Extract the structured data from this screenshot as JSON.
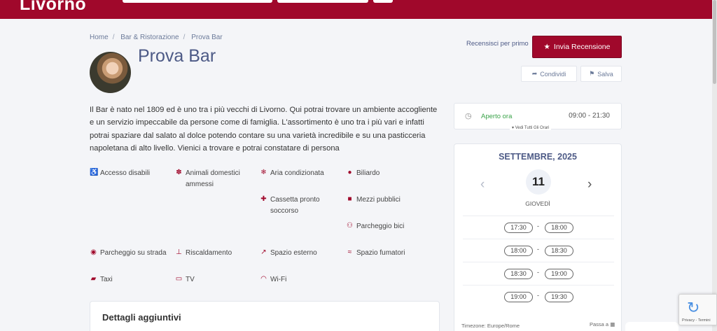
{
  "header": {
    "logo": "Livorno",
    "accent": "#a0082b"
  },
  "breadcrumb": [
    "Home",
    "Bar & Ristorazione",
    "Prova Bar"
  ],
  "breadcrumb_sep": "/",
  "listing": {
    "title": "Prova Bar",
    "description": "Il Bar è nato nel 1809 ed è uno tra i più vecchi di Livorno. Qui potrai trovare un ambiente accogliente e un servizio impeccabile da persone come di famiglia. L'assortimento è uno tra i più vari e infatti potrai spaziare dal salato al dolce potendo contare su una varietà incredibile e su una pasticceria napoletana di alto livello. Vienici a trovare e potrai constatare di persona"
  },
  "amenities": [
    {
      "label": "Accesso disabili",
      "icon": "wheelchair-icon"
    },
    {
      "label": "Animali domestici ammessi",
      "icon": "paw-icon"
    },
    {
      "label": "Aria condizionata",
      "icon": "snowflake-icon"
    },
    {
      "label": "Biliardo",
      "icon": "billiard-icon"
    },
    {
      "label": "Cassetta pronto soccorso",
      "icon": "first-aid-icon"
    },
    {
      "label": "Mezzi pubblici",
      "icon": "bus-icon"
    },
    {
      "label": "Parcheggio bici",
      "icon": "bicycle-icon"
    },
    {
      "label": "Parcheggio su strada",
      "icon": "parking-icon"
    },
    {
      "label": "Riscaldamento",
      "icon": "thermometer-icon"
    },
    {
      "label": "Spazio esterno",
      "icon": "external-link-icon"
    },
    {
      "label": "Spazio fumatori",
      "icon": "smoking-icon"
    },
    {
      "label": "Taxi",
      "icon": "car-icon"
    },
    {
      "label": "TV",
      "icon": "tv-icon"
    },
    {
      "label": "Wi-Fi",
      "icon": "wifi-icon"
    }
  ],
  "details_heading": "Dettagli aggiuntivi",
  "actions": {
    "review_first": "Recensisci per primo",
    "send_review": "Invia Recensione",
    "share": "Condividi",
    "save": "Salva"
  },
  "opening": {
    "status": "Aperto ora",
    "hours": "09:00 - 21:30",
    "all_hours_link": "Vedi Tutti Gli Orari",
    "status_color": "#3aa349"
  },
  "calendar": {
    "month": "SETTEMBRE, 2025",
    "day": "11",
    "weekday": "GIOVEDÌ",
    "slots": [
      {
        "from": "17:30",
        "to": "18:00"
      },
      {
        "from": "18:00",
        "to": "18:30"
      },
      {
        "from": "18:30",
        "to": "19:00"
      },
      {
        "from": "19:00",
        "to": "19:30"
      }
    ],
    "timezone": "Timezone: Europe/Rome",
    "jump": "Passa a"
  },
  "recaptcha": {
    "text": "Privacy - Termini"
  }
}
